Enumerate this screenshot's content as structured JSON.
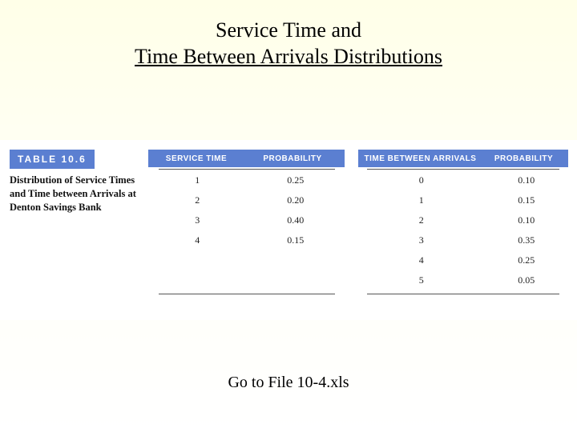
{
  "title": {
    "line1": "Service Time and",
    "line2": "Time Between Arrivals Distributions"
  },
  "table_label": "TABLE 10.6",
  "caption": "Distribution of Service Times and Time between Arrivals at Denton Savings Bank",
  "headers": {
    "service_time": "SERVICE TIME",
    "probability": "PROBABILITY",
    "time_between": "TIME BETWEEN ARRIVALS"
  },
  "service_dist": [
    {
      "value": "1",
      "prob": "0.25"
    },
    {
      "value": "2",
      "prob": "0.20"
    },
    {
      "value": "3",
      "prob": "0.40"
    },
    {
      "value": "4",
      "prob": "0.15"
    }
  ],
  "arrival_dist": [
    {
      "value": "0",
      "prob": "0.10"
    },
    {
      "value": "1",
      "prob": "0.15"
    },
    {
      "value": "2",
      "prob": "0.10"
    },
    {
      "value": "3",
      "prob": "0.35"
    },
    {
      "value": "4",
      "prob": "0.25"
    },
    {
      "value": "5",
      "prob": "0.05"
    }
  ],
  "footer": "Go to File 10-4.xls"
}
